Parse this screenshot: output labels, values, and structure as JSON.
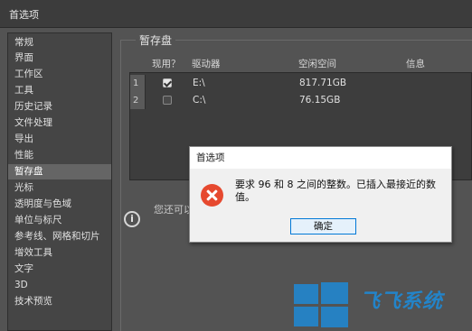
{
  "window": {
    "title": "首选项"
  },
  "sidebar": {
    "items": [
      {
        "label": "常规"
      },
      {
        "label": "界面"
      },
      {
        "label": "工作区"
      },
      {
        "label": "工具"
      },
      {
        "label": "历史记录"
      },
      {
        "label": "文件处理"
      },
      {
        "label": "导出"
      },
      {
        "label": "性能"
      },
      {
        "label": "暂存盘",
        "selected": true
      },
      {
        "label": "光标"
      },
      {
        "label": "透明度与色域"
      },
      {
        "label": "单位与标尺"
      },
      {
        "label": "参考线、网格和切片"
      },
      {
        "label": "增效工具"
      },
      {
        "label": "文字"
      },
      {
        "label": "3D"
      },
      {
        "label": "技术预览"
      }
    ]
  },
  "scratch": {
    "section_title": "暂存盘",
    "columns": {
      "active": "现用？",
      "drive": "驱动器",
      "free": "空闲空间",
      "info": "信息"
    },
    "rows": [
      {
        "num": "1",
        "checked": true,
        "drive": "E:\\",
        "free": "817.71GB"
      },
      {
        "num": "2",
        "checked": false,
        "drive": "C:\\",
        "free": "76.15GB"
      }
    ],
    "info_text": "您还可以"
  },
  "dialog": {
    "title": "首选项",
    "message": "要求 96 和 8 之间的整数。已插入最接近的数值。",
    "ok_label": "确定",
    "icon": "error-icon"
  },
  "watermark": {
    "text": "飞飞系统",
    "accent": "#1e8ad6"
  }
}
